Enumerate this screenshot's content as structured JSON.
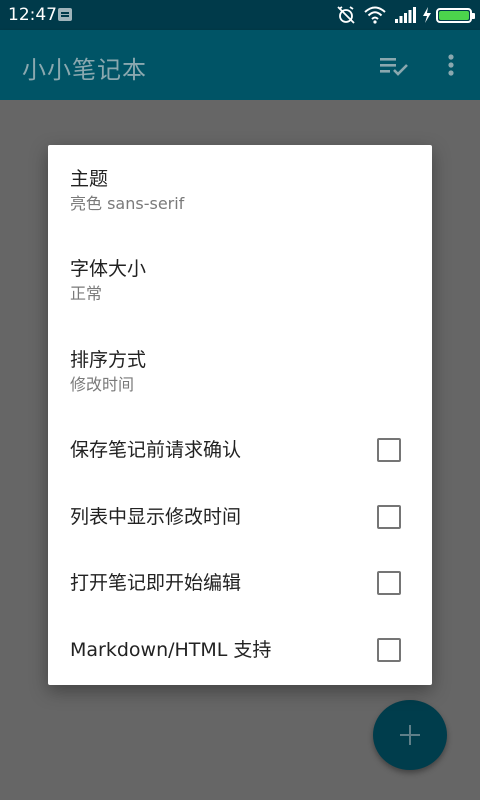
{
  "status_bar": {
    "time": "12:47",
    "icons": [
      "message-icon",
      "alarm-off-icon",
      "wifi-icon",
      "signal-icon",
      "charging-icon",
      "battery-icon"
    ],
    "battery_color": "#4cd44c"
  },
  "app_bar": {
    "title": "小小笔记本",
    "background": "#005466",
    "actions": [
      "checklist-icon",
      "more-vert-icon"
    ]
  },
  "dialog": {
    "theme": {
      "title": "主题",
      "summary": "亮色 sans-serif"
    },
    "font_size": {
      "title": "字体大小",
      "summary": "正常"
    },
    "sort_order": {
      "title": "排序方式",
      "summary": "修改时间"
    },
    "confirm_before_save": {
      "title": "保存笔记前请求确认",
      "checked": false
    },
    "show_modified_time": {
      "title": "列表中显示修改时间",
      "checked": false
    },
    "edit_on_open": {
      "title": "打开笔记即开始编辑",
      "checked": false
    },
    "markdown_html": {
      "title": "Markdown/HTML 支持",
      "checked": false
    }
  },
  "fab": {
    "icon": "add-icon",
    "color": "#003d4c"
  }
}
